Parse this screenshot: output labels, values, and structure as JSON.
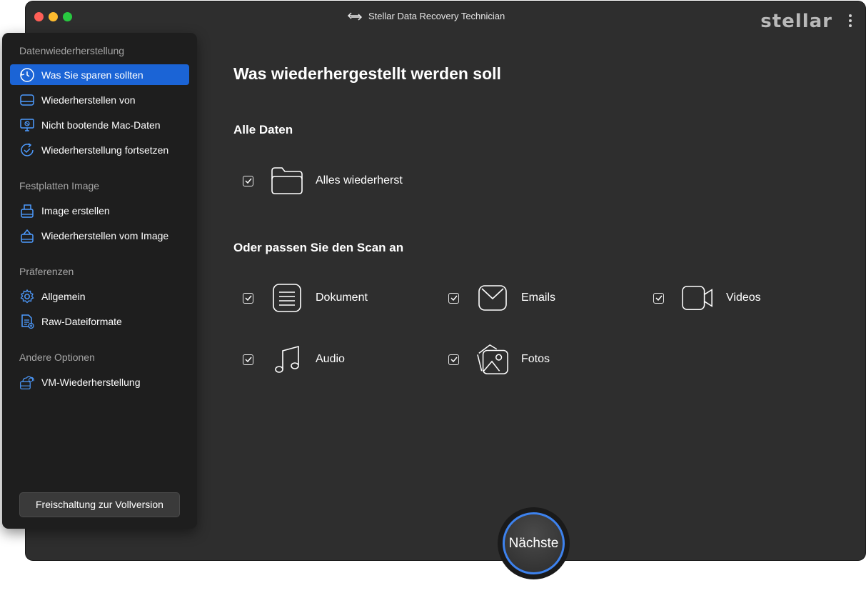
{
  "window": {
    "title": "Stellar Data Recovery Technician",
    "logo": "stellar"
  },
  "sidebar": {
    "sections": [
      {
        "title": "Datenwiederherstellung"
      },
      {
        "title": "Festplatten Image"
      },
      {
        "title": "Präferenzen"
      },
      {
        "title": "Andere Optionen"
      }
    ],
    "items": [
      {
        "label": "Was Sie sparen sollten",
        "icon": "restore-clock-icon",
        "active": true
      },
      {
        "label": "Wiederherstellen von",
        "icon": "drive-icon"
      },
      {
        "label": "Nicht bootende Mac-Daten",
        "icon": "monitor-icon"
      },
      {
        "label": "Wiederherstellung fortsetzen",
        "icon": "resume-icon"
      },
      {
        "label": "Image erstellen",
        "icon": "create-image-icon"
      },
      {
        "label": "Wiederherstellen vom Image",
        "icon": "restore-image-icon"
      },
      {
        "label": "Allgemein",
        "icon": "gear-icon"
      },
      {
        "label": "Raw-Dateiformate",
        "icon": "raw-file-icon"
      },
      {
        "label": "VM-Wiederherstellung",
        "icon": "vm-icon"
      }
    ],
    "unlock_label": "Freischaltung zur Vollversion"
  },
  "main": {
    "title": "Was wiederhergestellt werden soll",
    "all_data_heading": "Alle Daten",
    "custom_heading": "Oder passen Sie den Scan an",
    "all_option": {
      "label": "Alles wiederherst",
      "checked": true,
      "icon": "folder-icon"
    },
    "options": [
      {
        "label": "Dokument",
        "checked": true,
        "icon": "document-icon"
      },
      {
        "label": "Emails",
        "checked": true,
        "icon": "email-icon"
      },
      {
        "label": "Videos",
        "checked": true,
        "icon": "video-icon"
      },
      {
        "label": "Audio",
        "checked": true,
        "icon": "audio-icon"
      },
      {
        "label": "Fotos",
        "checked": true,
        "icon": "photos-icon"
      }
    ]
  },
  "next_label": "Nächste",
  "colors": {
    "accent": "#1b64d6",
    "ring": "#3d82ee",
    "window_bg": "#2e2e2e",
    "sidebar_bg": "#1e1e1e"
  }
}
